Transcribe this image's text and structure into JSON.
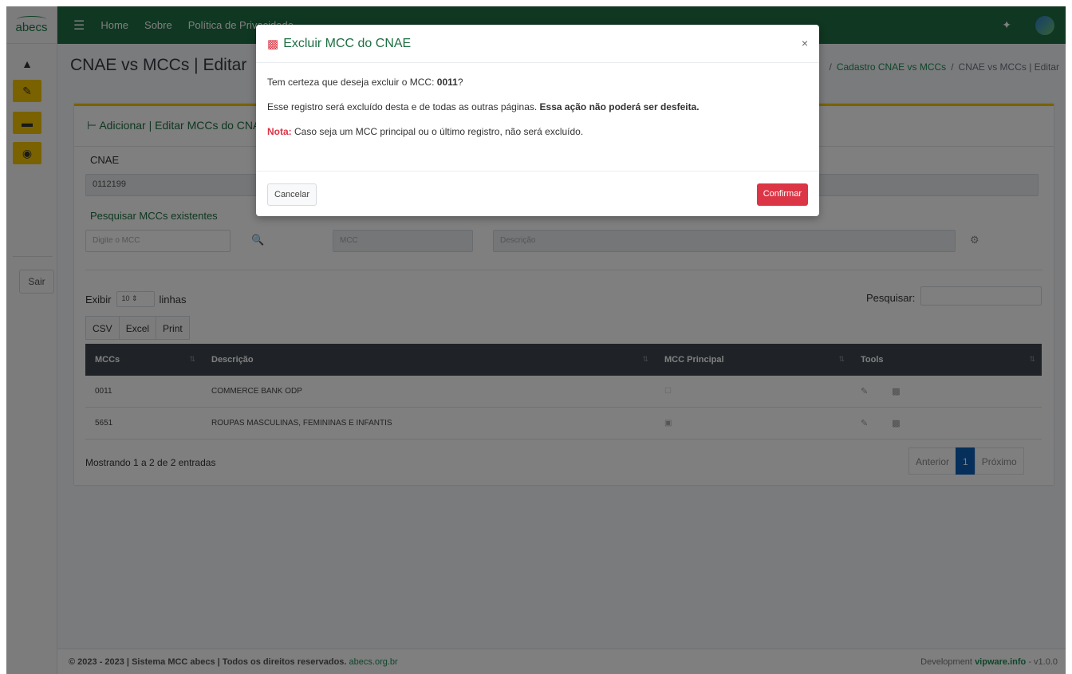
{
  "brand": {
    "logo_text": "abecs"
  },
  "navbar": {
    "items": [
      "Home",
      "Sobre",
      "Política de Privacidade"
    ]
  },
  "sidebar": {
    "logout_label": "Sair"
  },
  "page": {
    "title": "CNAE vs MCCs | Editar",
    "breadcrumb": [
      "Cadastro CNAE vs MCCs",
      "CNAE vs MCCs | Editar"
    ]
  },
  "card": {
    "title": "Adicionar | Editar MCCs do CNAE",
    "cnae_label": "CNAE",
    "cnae_value": "0112199",
    "search_label": "Pesquisar MCCs existentes",
    "mcc_input_placeholder": "Digite o MCC",
    "mcc_ro_placeholder": "MCC",
    "desc_ro_placeholder": "Descrição"
  },
  "table_controls": {
    "show_prefix": "Exibir",
    "page_length": "10",
    "show_suffix": "linhas",
    "search_label": "Pesquisar:",
    "buttons": [
      "CSV",
      "Excel",
      "Print"
    ]
  },
  "table": {
    "headers": [
      "MCCs",
      "Descrição",
      "MCC Principal",
      "Tools"
    ],
    "rows": [
      {
        "mcc": "0011",
        "descricao": "COMMERCE BANK ODP",
        "principal": false
      },
      {
        "mcc": "5651",
        "descricao": "ROUPAS MASCULINAS, FEMININAS E INFANTIS",
        "principal": true
      }
    ]
  },
  "pagination": {
    "info": "Mostrando 1 a 2 de 2 entradas",
    "prev": "Anterior",
    "current": "1",
    "next": "Próximo"
  },
  "footer": {
    "left_text": "© 2023 - 2023 | Sistema MCC abecs | Todos os direitos reservados.",
    "left_link": "abecs.org.br",
    "right_prefix": "Development",
    "right_link": "vipware.info",
    "version": "- v1.0.0"
  },
  "modal": {
    "title": "Excluir MCC do CNAE",
    "close": "×",
    "line1_prefix": "Tem certeza que deseja excluir o MCC:",
    "line1_code": "0011",
    "line1_suffix": "?",
    "line2_prefix": "Esse registro será excluído desta e de todas as outras páginas.",
    "line2_bold": "Essa ação não poderá ser desfeita.",
    "nota_label": "Nota:",
    "nota_text": "Caso seja um MCC principal ou o último registro, não será excluído.",
    "cancel_label": "Cancelar",
    "confirm_label": "Confirmar"
  },
  "colors": {
    "primary_green": "#1e6f43",
    "accent_yellow": "#f5c400",
    "danger": "#dc3545",
    "active_page": "#0d5fb6"
  },
  "icons": [
    "home-icon",
    "edit-icon",
    "server-icon",
    "shield-icon",
    "menu-icon",
    "expand-icon",
    "search-icon",
    "gear-icon",
    "trash-icon",
    "close-icon",
    "sort-icon",
    "checkbox-icon"
  ]
}
